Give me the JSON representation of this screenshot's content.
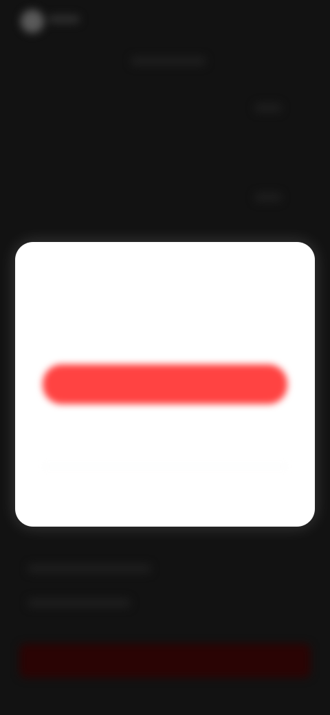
{
  "background": {
    "app_name": "",
    "bottom_button_label": ""
  },
  "dialog": {
    "title": "",
    "message": "",
    "primary_button_label": "",
    "secondary_link_label": "",
    "tertiary_link_label": ""
  },
  "colors": {
    "screen_background": "#121212",
    "dialog_background": "#ffffff",
    "primary_button": "#ff4342",
    "secondary_link": "#ff5a59",
    "tertiary_link": "#6f8a4e",
    "bottom_button": "#2a0404"
  },
  "icons": {
    "app_logo": "app-logo-icon"
  }
}
